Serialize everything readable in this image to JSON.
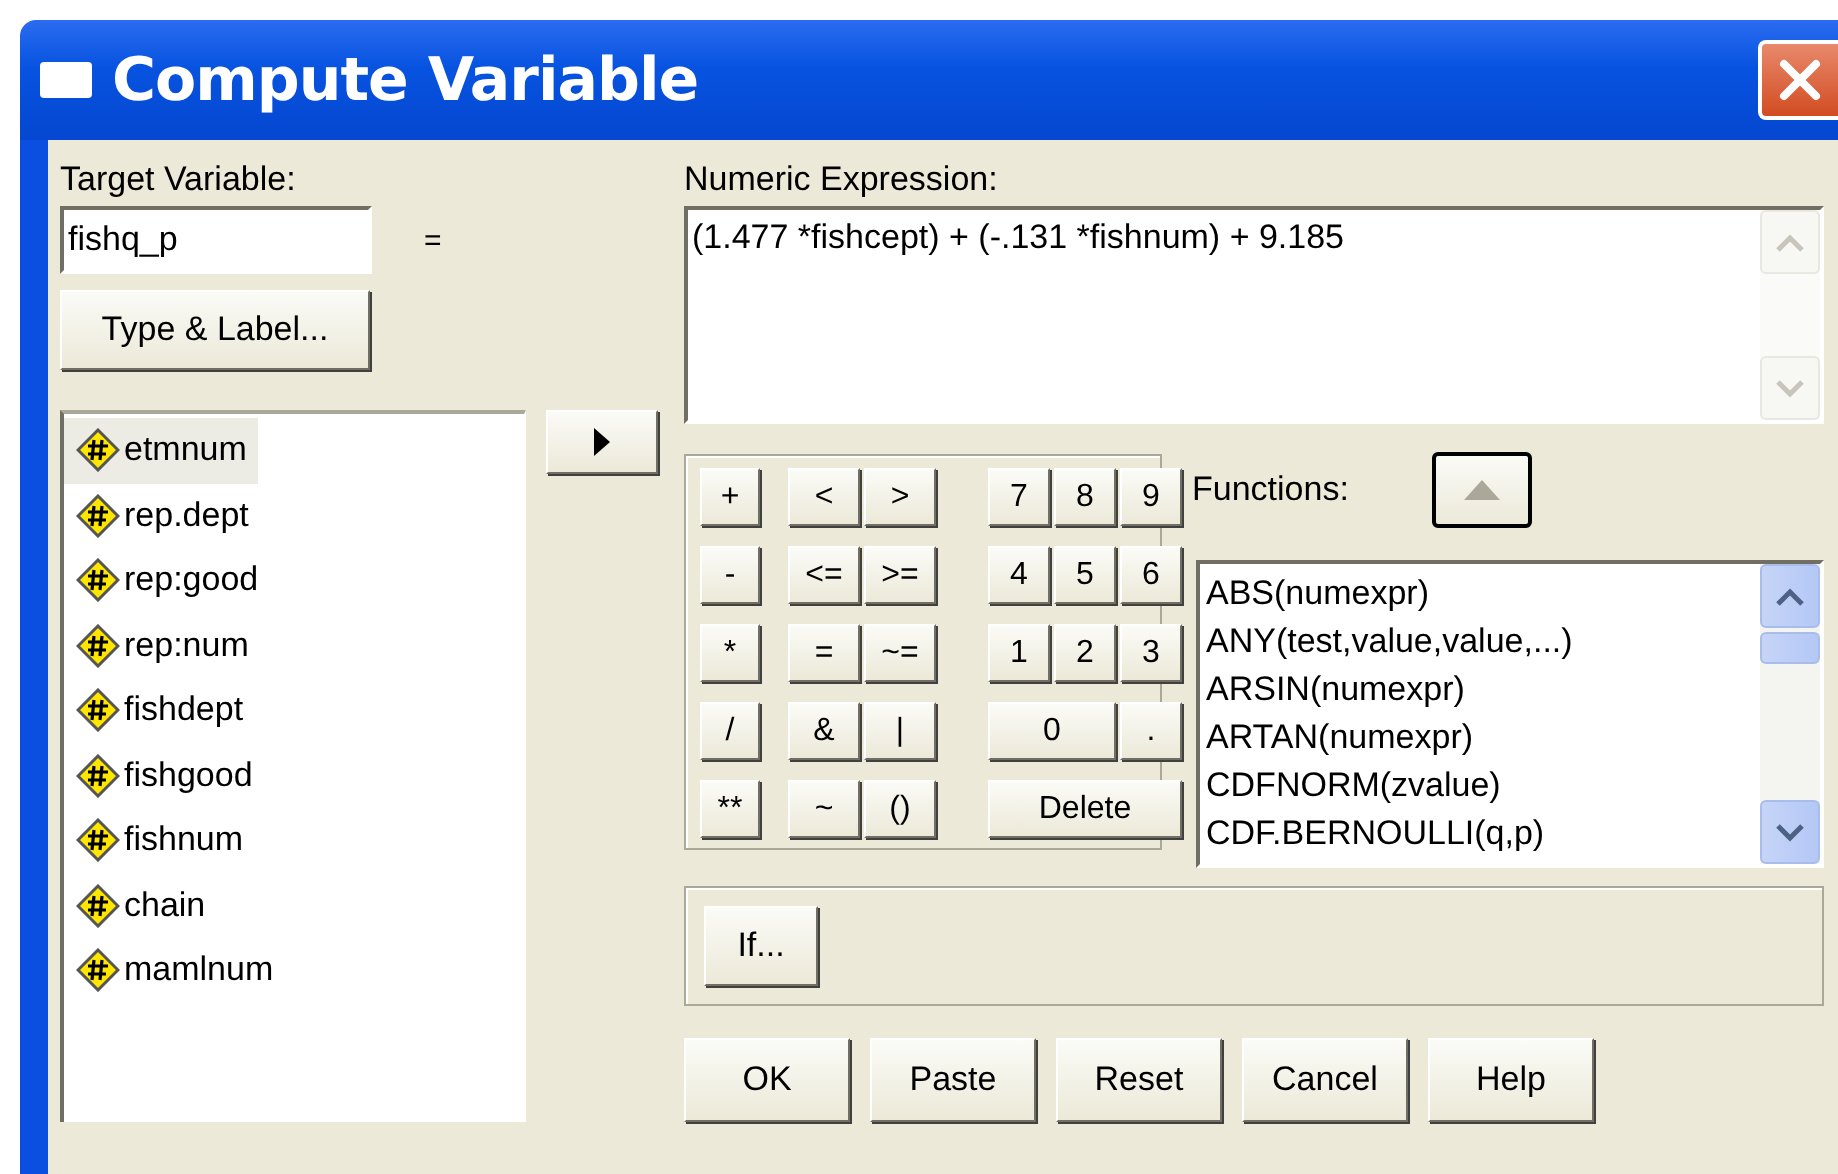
{
  "window": {
    "title": "Compute Variable"
  },
  "target_variable": {
    "label": "Target Variable:",
    "value": "fishq_p"
  },
  "equals": "=",
  "type_label_button": "Type & Label...",
  "variables": [
    {
      "name": "etmnum",
      "selected": true
    },
    {
      "name": "rep.dept",
      "selected": false
    },
    {
      "name": "rep:good",
      "selected": false
    },
    {
      "name": "rep:num",
      "selected": false
    },
    {
      "name": "fishdept",
      "selected": false
    },
    {
      "name": "fishgood",
      "selected": false
    },
    {
      "name": "fishnum",
      "selected": false
    },
    {
      "name": "chain",
      "selected": false
    },
    {
      "name": "mamlnum",
      "selected": false
    }
  ],
  "expression": {
    "label": "Numeric Expression:",
    "value": "(1.477 *fishcept) + (-.131 *fishnum) + 9.185"
  },
  "keypad": {
    "operators": [
      "+",
      "-",
      "*",
      "/",
      "**"
    ],
    "relations": [
      [
        "<",
        ">"
      ],
      [
        "<=",
        ">="
      ],
      [
        "=",
        "~="
      ],
      [
        "&",
        "|"
      ],
      [
        "~",
        "()"
      ]
    ],
    "digits": [
      [
        "7",
        "8",
        "9"
      ],
      [
        "4",
        "5",
        "6"
      ],
      [
        "1",
        "2",
        "3"
      ],
      [
        "0",
        "."
      ],
      [
        "Delete"
      ]
    ]
  },
  "functions": {
    "label": "Functions:",
    "items": [
      "ABS(numexpr)",
      "ANY(test,value,value,...)",
      "ARSIN(numexpr)",
      "ARTAN(numexpr)",
      "CDFNORM(zvalue)",
      "CDF.BERNOULLI(q,p)"
    ]
  },
  "if_button": "If...",
  "buttons": [
    "OK",
    "Paste",
    "Reset",
    "Cancel",
    "Help"
  ]
}
